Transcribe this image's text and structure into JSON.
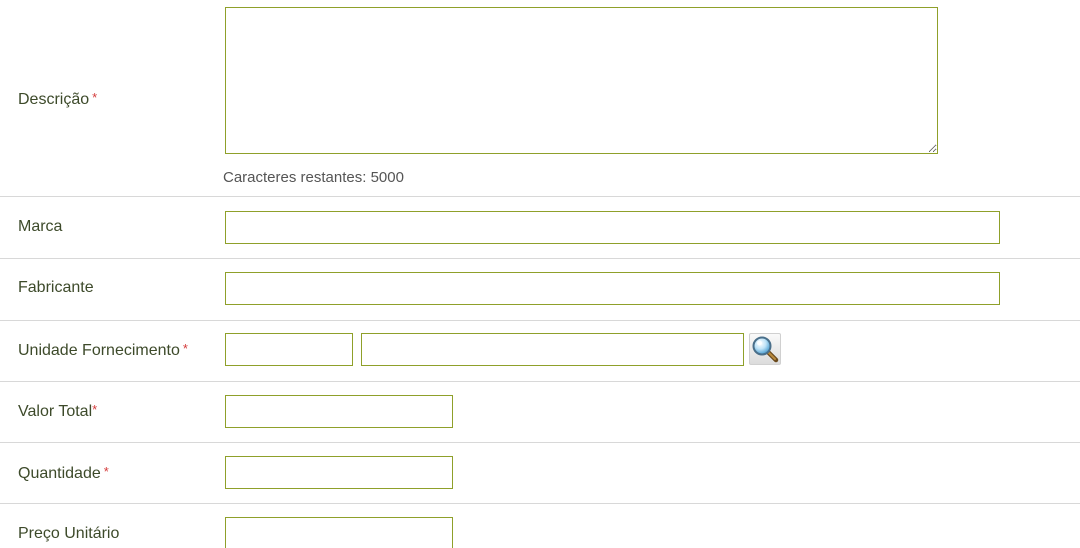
{
  "form": {
    "descricao": {
      "label": "Descrição",
      "required_mark": "*",
      "value": "",
      "chars_label": "Caracteres restantes:",
      "chars_remaining": "5000"
    },
    "marca": {
      "label": "Marca",
      "value": ""
    },
    "fabricante": {
      "label": "Fabricante",
      "value": ""
    },
    "unidade_fornecimento": {
      "label": "Unidade Fornecimento",
      "required_mark": "*",
      "code_value": "",
      "description_value": "",
      "lookup_icon": "magnifier-search-icon"
    },
    "valor_total": {
      "label": "Valor Total",
      "required_mark": "*",
      "value": ""
    },
    "quantidade": {
      "label": "Quantidade",
      "required_mark": "*",
      "value": ""
    },
    "preco_unitario": {
      "label": "Preço Unitário",
      "value": ""
    }
  },
  "colors": {
    "field_border": "#8fa02a",
    "label_text": "#3d4a2a",
    "required_mark": "#d43b3b",
    "row_divider": "#d8d8d8"
  }
}
